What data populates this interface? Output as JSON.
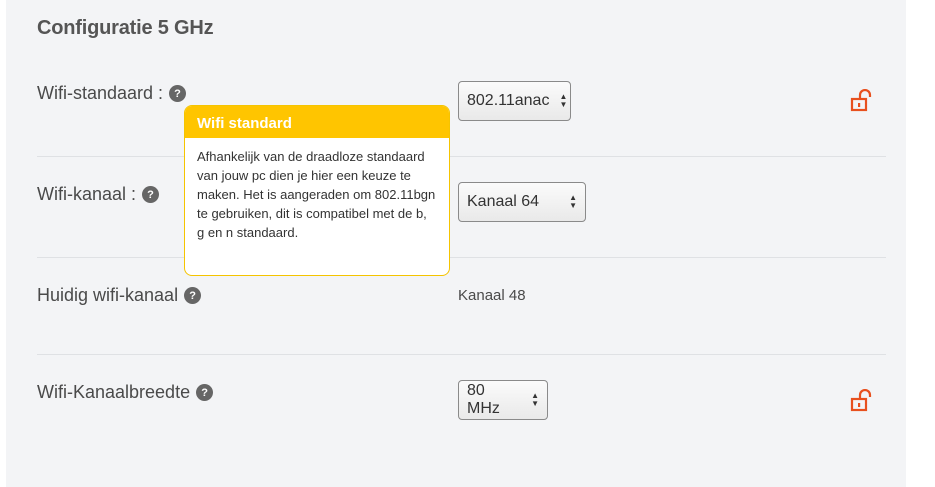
{
  "section": {
    "title": "Configuratie 5 GHz"
  },
  "rows": [
    {
      "label": "Wifi-standaard :",
      "control": "select",
      "value": "802.11anac",
      "lock": true
    },
    {
      "label": "Wifi-kanaal :",
      "control": "select",
      "value": "Kanaal 64",
      "lock": false
    },
    {
      "label": "Huidig wifi-kanaal",
      "control": "text",
      "value": "Kanaal 48",
      "lock": false
    },
    {
      "label": "Wifi-Kanaalbreedte",
      "control": "select",
      "value": "80 MHz",
      "lock": true
    }
  ],
  "help_icon_glyph": "?",
  "tooltip": {
    "title": "Wifi standard",
    "text": "Afhankelijk van de draadloze standaard van jouw pc dien je hier een keuze te maken. Het is aangeraden om 802.11bgn te gebruiken, dit is compatibel met de b, g en n standaard."
  },
  "colors": {
    "accent": "#e8501e",
    "tooltip_header": "#ffc500",
    "panel_bg": "#f3f4f6"
  },
  "icons": {
    "help": "help-icon",
    "lock": "unlocked-lock-icon",
    "select_arrows": "up-down-arrows-icon"
  }
}
